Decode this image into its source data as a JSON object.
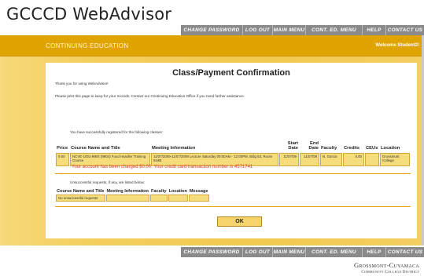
{
  "header": {
    "logo": "GCCCD WebAdvisor"
  },
  "nav": {
    "change_password": "Change Password",
    "log_out": "Log Out",
    "main_menu": "Main Menu",
    "cont_ed_menu": "Cont. Ed. Menu",
    "help": "Help",
    "contact_us": "Contact Us"
  },
  "banner": {
    "title": "CONTINUING EDUCATION",
    "welcome": "Welcome Student2!"
  },
  "page": {
    "title": "Class/Payment Confirmation",
    "thanks": "Thank you for using WebAdvisor!",
    "print_note": "Please print this page to keep for your records. Contact our Continuing Education Office if you need further assistance.",
    "registered_intro": "You have successfully registered for the following classes:",
    "charge_message": "Your account has been charged $0.00. Your credit card transaction number is 4571741",
    "unsuccessful_intro": "Unsuccessful requests, if any, are listed below:",
    "ok_label": "OK"
  },
  "registered_table": {
    "headers": {
      "price": "Price",
      "course": "Course Name and Title",
      "meeting": "Meeting Information",
      "start_1": "Start",
      "start_2": "Date",
      "end_1": "End",
      "end_2": "Date",
      "faculty": "Faculty",
      "credits": "Credits",
      "ceus": "CEUs",
      "location": "Location"
    },
    "row": {
      "price": "0.00",
      "course": "NCVE-1001-9904 (9904) Food Handler Training Course",
      "meeting": "11/07/2009-11/07/2009 Lecture Saturday 09:00AM - 12:00PM, Bldg 53, Room 544B",
      "start": "11/07/09",
      "end": "11/07/09",
      "faculty": "N. Garcia",
      "credits": "0.00",
      "ceus": "",
      "location": "Grossmont College"
    }
  },
  "unsuccessful_table": {
    "headers": {
      "course": "Course Name and Title",
      "meeting": "Meeting Information",
      "faculty": "Faculty",
      "location": "Location",
      "message": "Message"
    },
    "row": {
      "course": "No unsuccessful requests"
    }
  },
  "footer": {
    "logo_line1": "Grossmont-Cuyamaca",
    "logo_line2": "Community College District"
  },
  "colors": {
    "gold_banner": "#e0a400",
    "gold_frame": "#f1c94f",
    "cell_fill": "#f6dd7c",
    "nav_gray": "#8a8a8a",
    "charge_red": "#d63d3d"
  }
}
